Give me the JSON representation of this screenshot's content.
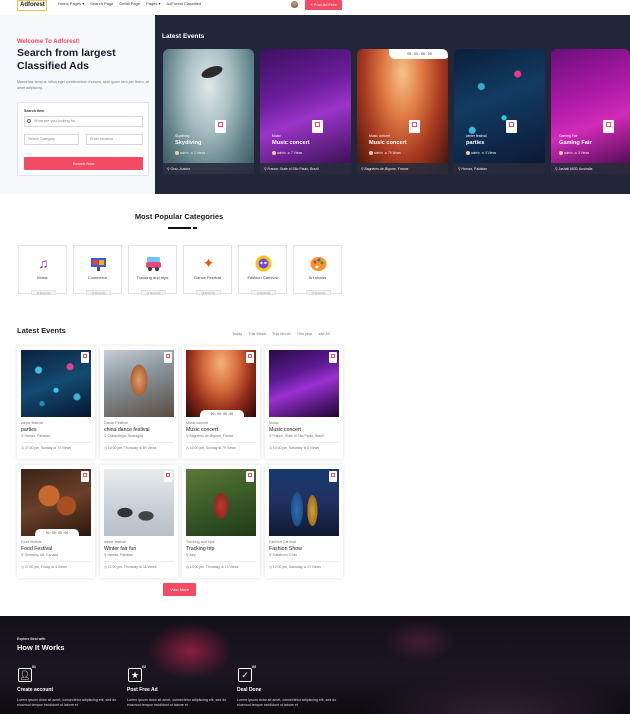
{
  "header": {
    "logo_text": "Adforest",
    "nav": [
      "Home Pages ▾",
      "Search Page",
      "Detail Page",
      "Pages ▾",
      "AdForest Classified"
    ],
    "post_ad_label": "+ Post Ad Free"
  },
  "hero": {
    "welcome": "Welcome To Adforest!",
    "title": "Search from largest Classified Ads",
    "description": "Maecenas tempus, tellus eget condimentum rhoncus, sem quam sem per libero, sit amet adipiscing.",
    "search": {
      "label": "Search Item",
      "keyword_placeholder": "What are you looking for...",
      "category_placeholder": "Select Category",
      "location_placeholder": "Enter location",
      "button": "Search Now"
    }
  },
  "latest_slider": {
    "title": "Latest Events",
    "cards": [
      {
        "category": "Skydiving",
        "name": "Skydiving",
        "author": "admin",
        "views": "2 Views",
        "location": "Graz, Austria",
        "timer": ""
      },
      {
        "category": "Music",
        "name": "Music concert",
        "author": "admin",
        "views": "7 Views",
        "location": "France, State of São Paulo, Brazil",
        "timer": ""
      },
      {
        "category": "Music concert",
        "name": "Music concert",
        "author": "admin",
        "views": "79 Views",
        "location": "Bagnères-de-Bigorre, France",
        "timer": "00 : 00 : 00 : 00"
      },
      {
        "category": "winter festival",
        "name": "parties",
        "author": "admin",
        "views": "4 Views",
        "location": "Hamza, Pakistan",
        "timer": ""
      },
      {
        "category": "Gaming Fair",
        "name": "Gaming Fair",
        "author": "admin",
        "views": "3 Views",
        "location": "Jashall 6630, Australia",
        "timer": ""
      }
    ]
  },
  "categories": {
    "title": "Most Popular Categories",
    "items": [
      {
        "name": "Music",
        "count": "(1 Events)",
        "icon": "music-notes-icon"
      },
      {
        "name": "Commerce",
        "count": "(1 Events)",
        "icon": "commerce-icon"
      },
      {
        "name": "Tracking and trips",
        "count": "(1 Events)",
        "icon": "car-icon"
      },
      {
        "name": "Dance Festival",
        "count": "(1 Events)",
        "icon": "dancer-icon"
      },
      {
        "name": "Fashion Carnival",
        "count": "(1 Events)",
        "icon": "carnival-mask-icon"
      },
      {
        "name": "Art shows",
        "count": "(1 Events)",
        "icon": "palette-icon"
      }
    ]
  },
  "events": {
    "title": "Latest Events",
    "filters": [
      "Today",
      "This Week",
      "This Month",
      "This year",
      "see All"
    ],
    "items": [
      {
        "category": "winter festival",
        "name": "parties",
        "location": "Hamza, Pakistan",
        "meta": "07:00 pm, Sunday  ⊚ 74 Views",
        "timer": ""
      },
      {
        "category": "Dance Festival",
        "name": "china dance festival",
        "location": "Chinandega, Nicaragua",
        "meta": "10:00 pm, Thursday  ⊚ 89 Views",
        "timer": ""
      },
      {
        "category": "Music concert",
        "name": "Music concert",
        "location": "Bagnères-de-Bigorre, France",
        "meta": "10:00 pm, Sunday  ⊚ 79 Views",
        "timer": "00 : 00 : 00 : 00"
      },
      {
        "category": "Music",
        "name": "Music concert",
        "location": "France, State of São Paulo, Brazil",
        "meta": "10:00 pm, Saturday  ⊚ 8 Views",
        "timer": ""
      },
      {
        "category": "Food festival",
        "name": "Food Festival",
        "location": "Germany, AB, Canada",
        "meta": "07:00 pm, Friday  ⊚ 4 Views",
        "timer": "00 : 00 : 00 : 00"
      },
      {
        "category": "winter festival",
        "name": "Winter fair fun",
        "location": "Hamza, Pakistan",
        "meta": "12:00 pm, Thursday  ⊚ 34 Views",
        "timer": ""
      },
      {
        "category": "Tracking and trips",
        "name": "Tracking trip",
        "location": "Italy",
        "meta": "10:00 pm, Thursday  ⊚ 19 Views",
        "timer": ""
      },
      {
        "category": "Fashion Carnival",
        "name": "Fashion Show",
        "location": "Sukabumi, Chile",
        "meta": "12:00 pm, Saturday  ⊚ 20 Views",
        "timer": ""
      }
    ],
    "view_more": "View More"
  },
  "how_it_works": {
    "small_label": "Explore Best with",
    "title": "How It Works",
    "steps": [
      {
        "num": "01",
        "title": "Create account",
        "desc": "Lorem ipsum dolor sit amet, consectetur adipiscing elit, sed do eiusmod tempor incididunt ut labore et"
      },
      {
        "num": "02",
        "title": "Post Free Ad",
        "desc": "Lorem ipsum dolor sit amet, consectetur adipiscing elit, sed do eiusmod tempor incididunt ut labore et"
      },
      {
        "num": "03",
        "title": "Deal Done",
        "desc": "Lorem ipsum dolor sit amet, consectetur adipiscing elit, sed do eiusmod tempor incididunt ut labore et"
      }
    ]
  },
  "colors": {
    "accent": "#f44b64",
    "dark": "#23263a"
  }
}
